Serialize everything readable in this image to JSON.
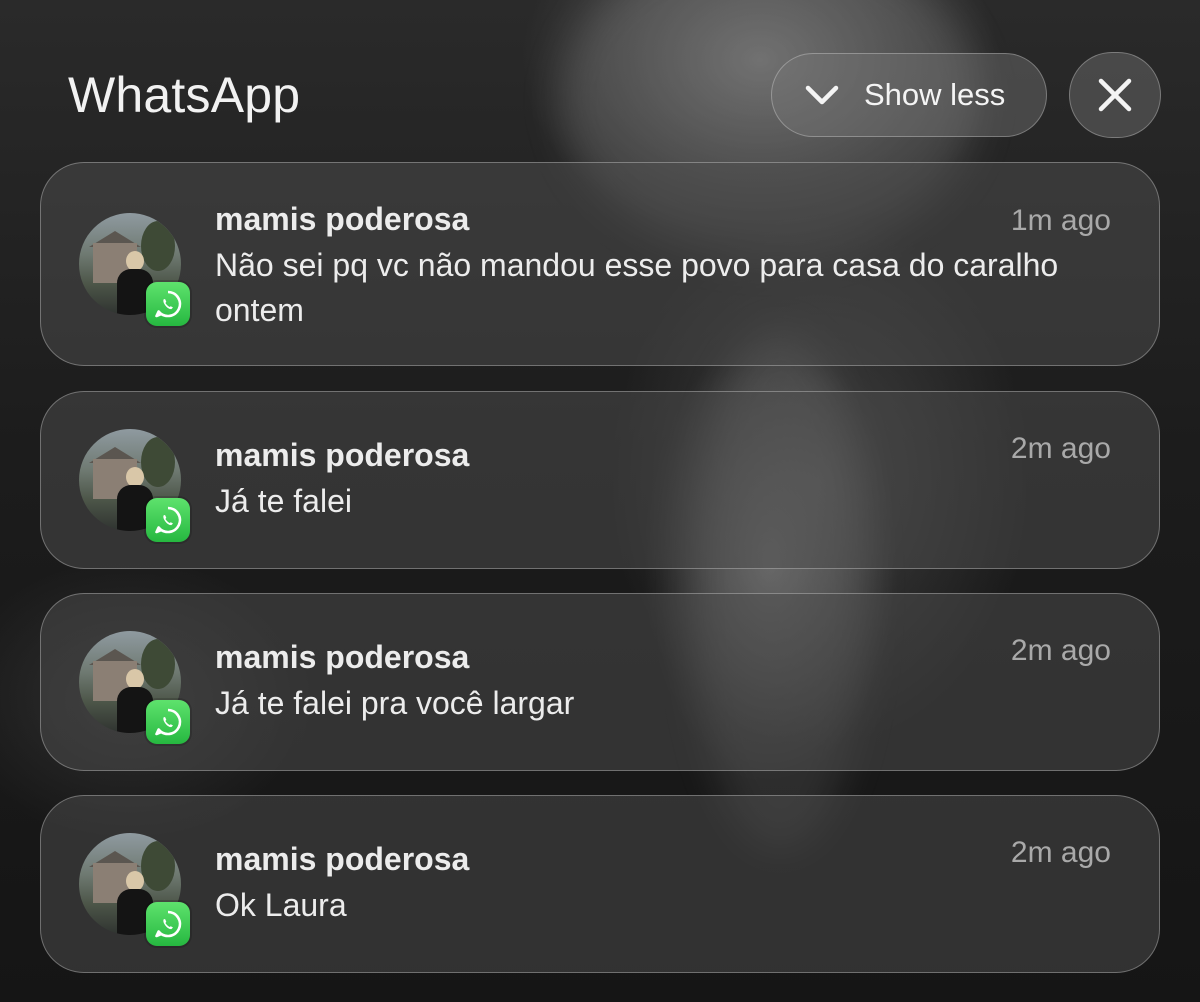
{
  "app": {
    "title": "WhatsApp"
  },
  "controls": {
    "show_less_label": "Show less",
    "show_less_icon": "chevron-down-icon",
    "close_icon": "close-icon"
  },
  "colors": {
    "badge_green": "#25D366",
    "text_primary": "#ECECEC",
    "text_secondary": "#A9A9A9"
  },
  "notifications": [
    {
      "sender": "mamis poderosa",
      "time": "1m ago",
      "message": "Não sei pq vc não mandou esse povo para casa do caralho ontem",
      "badge_icon": "whatsapp-icon"
    },
    {
      "sender": "mamis poderosa",
      "time": "2m ago",
      "message": "Já te falei",
      "badge_icon": "whatsapp-icon"
    },
    {
      "sender": "mamis poderosa",
      "time": "2m ago",
      "message": "Já te falei pra você largar",
      "badge_icon": "whatsapp-icon"
    },
    {
      "sender": "mamis poderosa",
      "time": "2m ago",
      "message": "Ok Laura",
      "badge_icon": "whatsapp-icon"
    }
  ]
}
